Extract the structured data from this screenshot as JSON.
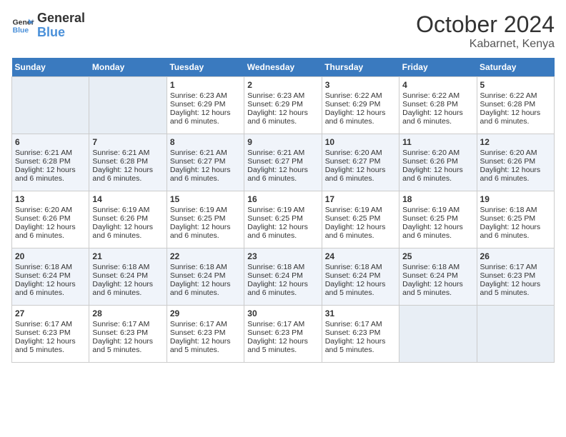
{
  "logo": {
    "line1": "General",
    "line2": "Blue"
  },
  "title": "October 2024",
  "location": "Kabarnet, Kenya",
  "days_of_week": [
    "Sunday",
    "Monday",
    "Tuesday",
    "Wednesday",
    "Thursday",
    "Friday",
    "Saturday"
  ],
  "weeks": [
    [
      {
        "day": "",
        "sunrise": "",
        "sunset": "",
        "daylight": ""
      },
      {
        "day": "",
        "sunrise": "",
        "sunset": "",
        "daylight": ""
      },
      {
        "day": "1",
        "sunrise": "Sunrise: 6:23 AM",
        "sunset": "Sunset: 6:29 PM",
        "daylight": "Daylight: 12 hours and 6 minutes."
      },
      {
        "day": "2",
        "sunrise": "Sunrise: 6:23 AM",
        "sunset": "Sunset: 6:29 PM",
        "daylight": "Daylight: 12 hours and 6 minutes."
      },
      {
        "day": "3",
        "sunrise": "Sunrise: 6:22 AM",
        "sunset": "Sunset: 6:29 PM",
        "daylight": "Daylight: 12 hours and 6 minutes."
      },
      {
        "day": "4",
        "sunrise": "Sunrise: 6:22 AM",
        "sunset": "Sunset: 6:28 PM",
        "daylight": "Daylight: 12 hours and 6 minutes."
      },
      {
        "day": "5",
        "sunrise": "Sunrise: 6:22 AM",
        "sunset": "Sunset: 6:28 PM",
        "daylight": "Daylight: 12 hours and 6 minutes."
      }
    ],
    [
      {
        "day": "6",
        "sunrise": "Sunrise: 6:21 AM",
        "sunset": "Sunset: 6:28 PM",
        "daylight": "Daylight: 12 hours and 6 minutes."
      },
      {
        "day": "7",
        "sunrise": "Sunrise: 6:21 AM",
        "sunset": "Sunset: 6:28 PM",
        "daylight": "Daylight: 12 hours and 6 minutes."
      },
      {
        "day": "8",
        "sunrise": "Sunrise: 6:21 AM",
        "sunset": "Sunset: 6:27 PM",
        "daylight": "Daylight: 12 hours and 6 minutes."
      },
      {
        "day": "9",
        "sunrise": "Sunrise: 6:21 AM",
        "sunset": "Sunset: 6:27 PM",
        "daylight": "Daylight: 12 hours and 6 minutes."
      },
      {
        "day": "10",
        "sunrise": "Sunrise: 6:20 AM",
        "sunset": "Sunset: 6:27 PM",
        "daylight": "Daylight: 12 hours and 6 minutes."
      },
      {
        "day": "11",
        "sunrise": "Sunrise: 6:20 AM",
        "sunset": "Sunset: 6:26 PM",
        "daylight": "Daylight: 12 hours and 6 minutes."
      },
      {
        "day": "12",
        "sunrise": "Sunrise: 6:20 AM",
        "sunset": "Sunset: 6:26 PM",
        "daylight": "Daylight: 12 hours and 6 minutes."
      }
    ],
    [
      {
        "day": "13",
        "sunrise": "Sunrise: 6:20 AM",
        "sunset": "Sunset: 6:26 PM",
        "daylight": "Daylight: 12 hours and 6 minutes."
      },
      {
        "day": "14",
        "sunrise": "Sunrise: 6:19 AM",
        "sunset": "Sunset: 6:26 PM",
        "daylight": "Daylight: 12 hours and 6 minutes."
      },
      {
        "day": "15",
        "sunrise": "Sunrise: 6:19 AM",
        "sunset": "Sunset: 6:25 PM",
        "daylight": "Daylight: 12 hours and 6 minutes."
      },
      {
        "day": "16",
        "sunrise": "Sunrise: 6:19 AM",
        "sunset": "Sunset: 6:25 PM",
        "daylight": "Daylight: 12 hours and 6 minutes."
      },
      {
        "day": "17",
        "sunrise": "Sunrise: 6:19 AM",
        "sunset": "Sunset: 6:25 PM",
        "daylight": "Daylight: 12 hours and 6 minutes."
      },
      {
        "day": "18",
        "sunrise": "Sunrise: 6:19 AM",
        "sunset": "Sunset: 6:25 PM",
        "daylight": "Daylight: 12 hours and 6 minutes."
      },
      {
        "day": "19",
        "sunrise": "Sunrise: 6:18 AM",
        "sunset": "Sunset: 6:25 PM",
        "daylight": "Daylight: 12 hours and 6 minutes."
      }
    ],
    [
      {
        "day": "20",
        "sunrise": "Sunrise: 6:18 AM",
        "sunset": "Sunset: 6:24 PM",
        "daylight": "Daylight: 12 hours and 6 minutes."
      },
      {
        "day": "21",
        "sunrise": "Sunrise: 6:18 AM",
        "sunset": "Sunset: 6:24 PM",
        "daylight": "Daylight: 12 hours and 6 minutes."
      },
      {
        "day": "22",
        "sunrise": "Sunrise: 6:18 AM",
        "sunset": "Sunset: 6:24 PM",
        "daylight": "Daylight: 12 hours and 6 minutes."
      },
      {
        "day": "23",
        "sunrise": "Sunrise: 6:18 AM",
        "sunset": "Sunset: 6:24 PM",
        "daylight": "Daylight: 12 hours and 6 minutes."
      },
      {
        "day": "24",
        "sunrise": "Sunrise: 6:18 AM",
        "sunset": "Sunset: 6:24 PM",
        "daylight": "Daylight: 12 hours and 5 minutes."
      },
      {
        "day": "25",
        "sunrise": "Sunrise: 6:18 AM",
        "sunset": "Sunset: 6:24 PM",
        "daylight": "Daylight: 12 hours and 5 minutes."
      },
      {
        "day": "26",
        "sunrise": "Sunrise: 6:17 AM",
        "sunset": "Sunset: 6:23 PM",
        "daylight": "Daylight: 12 hours and 5 minutes."
      }
    ],
    [
      {
        "day": "27",
        "sunrise": "Sunrise: 6:17 AM",
        "sunset": "Sunset: 6:23 PM",
        "daylight": "Daylight: 12 hours and 5 minutes."
      },
      {
        "day": "28",
        "sunrise": "Sunrise: 6:17 AM",
        "sunset": "Sunset: 6:23 PM",
        "daylight": "Daylight: 12 hours and 5 minutes."
      },
      {
        "day": "29",
        "sunrise": "Sunrise: 6:17 AM",
        "sunset": "Sunset: 6:23 PM",
        "daylight": "Daylight: 12 hours and 5 minutes."
      },
      {
        "day": "30",
        "sunrise": "Sunrise: 6:17 AM",
        "sunset": "Sunset: 6:23 PM",
        "daylight": "Daylight: 12 hours and 5 minutes."
      },
      {
        "day": "31",
        "sunrise": "Sunrise: 6:17 AM",
        "sunset": "Sunset: 6:23 PM",
        "daylight": "Daylight: 12 hours and 5 minutes."
      },
      {
        "day": "",
        "sunrise": "",
        "sunset": "",
        "daylight": ""
      },
      {
        "day": "",
        "sunrise": "",
        "sunset": "",
        "daylight": ""
      }
    ]
  ]
}
